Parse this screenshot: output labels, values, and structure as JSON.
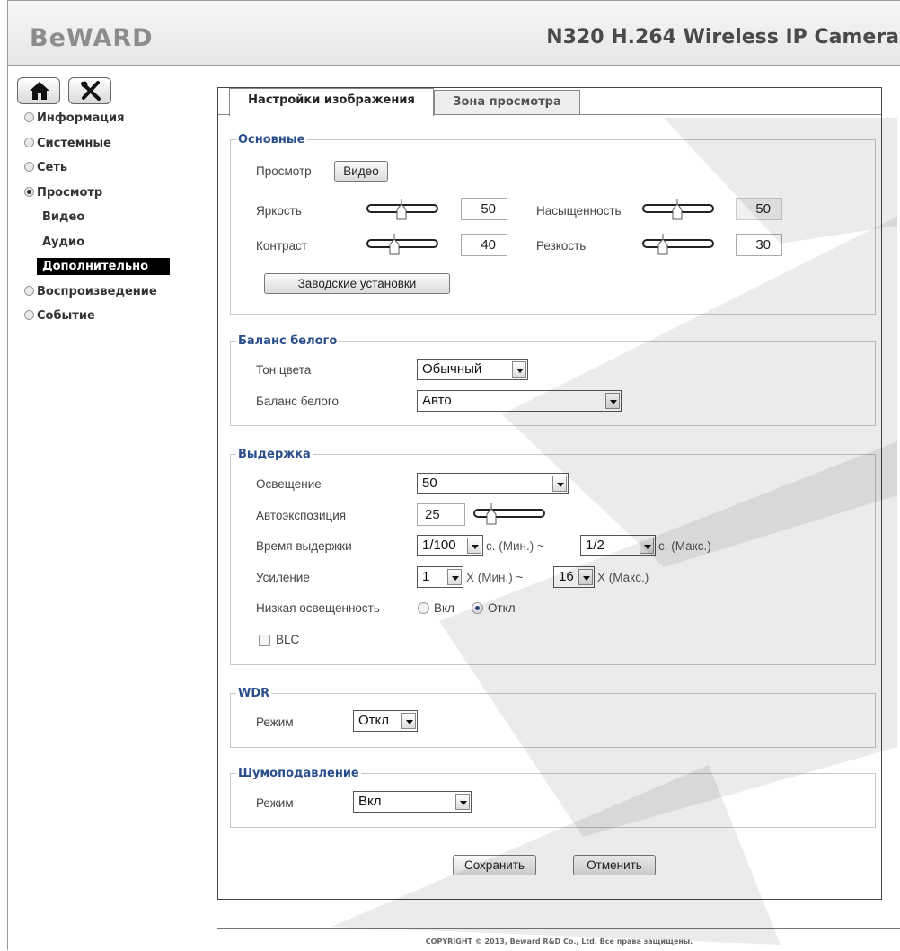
{
  "header": {
    "logo": "BeWARD",
    "title": "N320 H.264 Wireless IP Camera"
  },
  "sidebar": {
    "buttons": [
      {
        "icon": "home-icon"
      },
      {
        "icon": "tools-icon"
      }
    ],
    "items": [
      {
        "label": "Информация",
        "type": "section",
        "selected": false
      },
      {
        "label": "Системные",
        "type": "section",
        "selected": false
      },
      {
        "label": "Сеть",
        "type": "section",
        "selected": false
      },
      {
        "label": "Просмотр",
        "type": "section",
        "selected": true
      },
      {
        "label": "Видео",
        "type": "sub"
      },
      {
        "label": "Аудио",
        "type": "sub"
      },
      {
        "label": "Дополнительно",
        "type": "sub",
        "active": true
      },
      {
        "label": "Воспроизведение",
        "type": "section",
        "selected": false
      },
      {
        "label": "Событие",
        "type": "section",
        "selected": false
      }
    ]
  },
  "tabs": [
    {
      "label": "Настройки изображения",
      "active": true
    },
    {
      "label": "Зона просмотра",
      "active": false
    }
  ],
  "basic": {
    "legend": "Основные",
    "preview_label": "Просмотр",
    "preview_button": "Видео",
    "brightness_label": "Яркость",
    "brightness_value": "50",
    "saturation_label": "Насыщенность",
    "saturation_value": "50",
    "contrast_label": "Контраст",
    "contrast_value": "40",
    "sharpness_label": "Резкость",
    "sharpness_value": "30",
    "factory_button": "Заводские установки"
  },
  "wb": {
    "legend": "Баланс белого",
    "tone_label": "Тон цвета",
    "tone_value": "Обычный",
    "balance_label": "Баланс белого",
    "balance_value": "Авто"
  },
  "exposure": {
    "legend": "Выдержка",
    "lighting_label": "Освещение",
    "lighting_value": "50",
    "ae_label": "Автоэкспозиция",
    "ae_value": "25",
    "shutter_label": "Время выдержки",
    "shutter_min": "1/100",
    "shutter_unit_min": "с. (Мин.) ~",
    "shutter_max": "1/2",
    "shutter_unit_max": "с. (Макс.)",
    "gain_label": "Усиление",
    "gain_min": "1",
    "gain_unit_min": "X (Мин.) ~",
    "gain_max": "16",
    "gain_unit_max": "X (Макс.)",
    "lowlight_label": "Низкая освещенность",
    "lowlight_on": "Вкл",
    "lowlight_off": "Откл",
    "lowlight_selected": "Откл",
    "blc_label": "BLC",
    "blc_checked": false
  },
  "wdr": {
    "legend": "WDR",
    "mode_label": "Режим",
    "mode_value": "Откл"
  },
  "noise": {
    "legend": "Шумоподавление",
    "mode_label": "Режим",
    "mode_value": "Вкл"
  },
  "actions": {
    "save": "Сохранить",
    "cancel": "Отменить"
  },
  "footer": {
    "copyright": "COPYRIGHT © 2013, Beward R&D Co., Ltd. Все права защищены."
  },
  "colors": {
    "legend": "#2a4e8c",
    "active_nav_bg": "#000000",
    "watermark": "#e6e6e6"
  }
}
